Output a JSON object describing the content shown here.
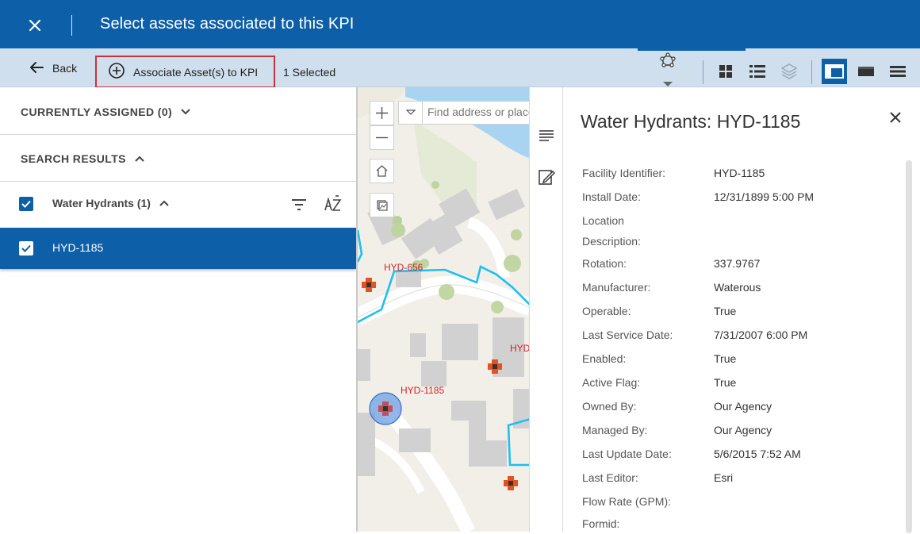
{
  "titlebar": {
    "title": "Select assets associated to this KPI",
    "close_icon": "close-icon"
  },
  "toolbar": {
    "back_label": "Back",
    "associate_label": "Associate Asset(s) to KPI",
    "selected_count": "1 Selected",
    "icons": [
      "filter-shape-icon",
      "grid-view-icon",
      "list-view-icon",
      "layers-icon",
      "layout-split-icon",
      "layout-map-icon",
      "layout-list-icon"
    ]
  },
  "left_panel": {
    "currently_assigned": "CURRENTLY ASSIGNED (0)",
    "search_results": "SEARCH RESULTS",
    "group_label": "Water Hydrants (1)",
    "selected_item": "HYD-1185"
  },
  "map": {
    "search_placeholder": "Find address or place",
    "labels": [
      "HYD-656",
      "HYD",
      "HYD-1185"
    ]
  },
  "details": {
    "title": "Water Hydrants: HYD-1185",
    "attributes": [
      {
        "label": "Facility Identifier:",
        "value": "HYD-1185"
      },
      {
        "label": "Install Date:",
        "value": "12/31/1899 5:00 PM"
      },
      {
        "label": "Location Description:",
        "value": ""
      },
      {
        "label": "Rotation:",
        "value": "337.9767"
      },
      {
        "label": "Manufacturer:",
        "value": "Waterous"
      },
      {
        "label": "Operable:",
        "value": "True"
      },
      {
        "label": "Last Service Date:",
        "value": "7/31/2007 6:00 PM"
      },
      {
        "label": "Enabled:",
        "value": "True"
      },
      {
        "label": "Active Flag:",
        "value": "True"
      },
      {
        "label": "Owned By:",
        "value": "Our Agency"
      },
      {
        "label": "Managed By:",
        "value": "Our Agency"
      },
      {
        "label": "Last Update Date:",
        "value": "5/6/2015 7:52 AM"
      },
      {
        "label": "Last Editor:",
        "value": "Esri"
      },
      {
        "label": "Flow Rate (GPM):",
        "value": ""
      },
      {
        "label": "Formid:",
        "value": ""
      }
    ]
  },
  "colors": {
    "brand_blue": "#0d5fa8",
    "toolbar_bg": "#cfdfee",
    "highlight_red": "#c8323b",
    "hydrant_orange": "#e8501f",
    "water_line": "#1ec0f0"
  }
}
